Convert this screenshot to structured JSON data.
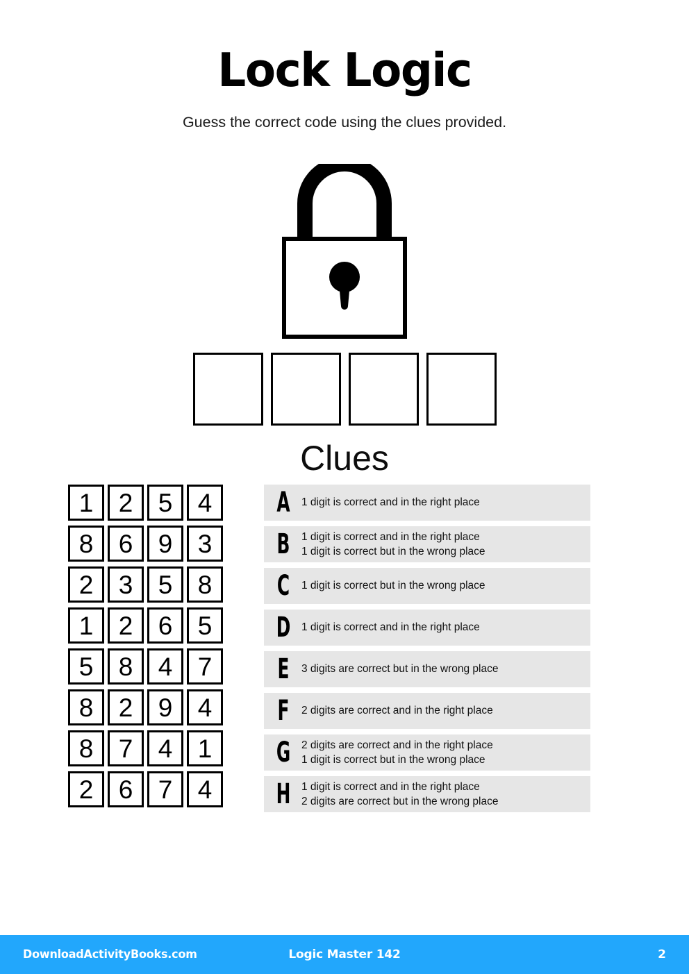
{
  "header": {
    "title": "Lock Logic",
    "subtitle": "Guess the correct code using the clues provided."
  },
  "lock": {
    "icon": "padlock-icon"
  },
  "answer": {
    "boxes": [
      "",
      "",
      "",
      ""
    ]
  },
  "clues_section": {
    "heading": "Clues"
  },
  "guesses": [
    {
      "label": "A",
      "digits": [
        "1",
        "2",
        "5",
        "4"
      ]
    },
    {
      "label": "B",
      "digits": [
        "8",
        "6",
        "9",
        "3"
      ]
    },
    {
      "label": "C",
      "digits": [
        "2",
        "3",
        "5",
        "8"
      ]
    },
    {
      "label": "D",
      "digits": [
        "1",
        "2",
        "6",
        "5"
      ]
    },
    {
      "label": "E",
      "digits": [
        "5",
        "8",
        "4",
        "7"
      ]
    },
    {
      "label": "F",
      "digits": [
        "8",
        "2",
        "9",
        "4"
      ]
    },
    {
      "label": "G",
      "digits": [
        "8",
        "7",
        "4",
        "1"
      ]
    },
    {
      "label": "H",
      "digits": [
        "2",
        "6",
        "7",
        "4"
      ]
    }
  ],
  "clues": [
    {
      "letter": "A",
      "lines": [
        "1 digit is correct and in the right place"
      ]
    },
    {
      "letter": "B",
      "lines": [
        "1 digit is correct and in the right place",
        "1 digit is correct but in the wrong place"
      ]
    },
    {
      "letter": "C",
      "lines": [
        "1 digit is correct but in the wrong place"
      ]
    },
    {
      "letter": "D",
      "lines": [
        "1 digit is correct and in the right place"
      ]
    },
    {
      "letter": "E",
      "lines": [
        "3 digits are correct but in the wrong place"
      ]
    },
    {
      "letter": "F",
      "lines": [
        "2 digits are correct and in the right place"
      ]
    },
    {
      "letter": "G",
      "lines": [
        "2 digits are correct and in the right place",
        "1 digit is correct but in the wrong place"
      ]
    },
    {
      "letter": "H",
      "lines": [
        "1 digit is correct and in the right place",
        "2 digits are correct but in the wrong place"
      ]
    }
  ],
  "footer": {
    "site": "DownloadActivityBooks.com",
    "book": "Logic Master 142",
    "page": "2",
    "background_color": "#22a7fc",
    "text_color": "#ffffff"
  },
  "colors": {
    "clue_row_background": "#e6e6e6",
    "ink": "#000000",
    "page_background": "#ffffff"
  }
}
